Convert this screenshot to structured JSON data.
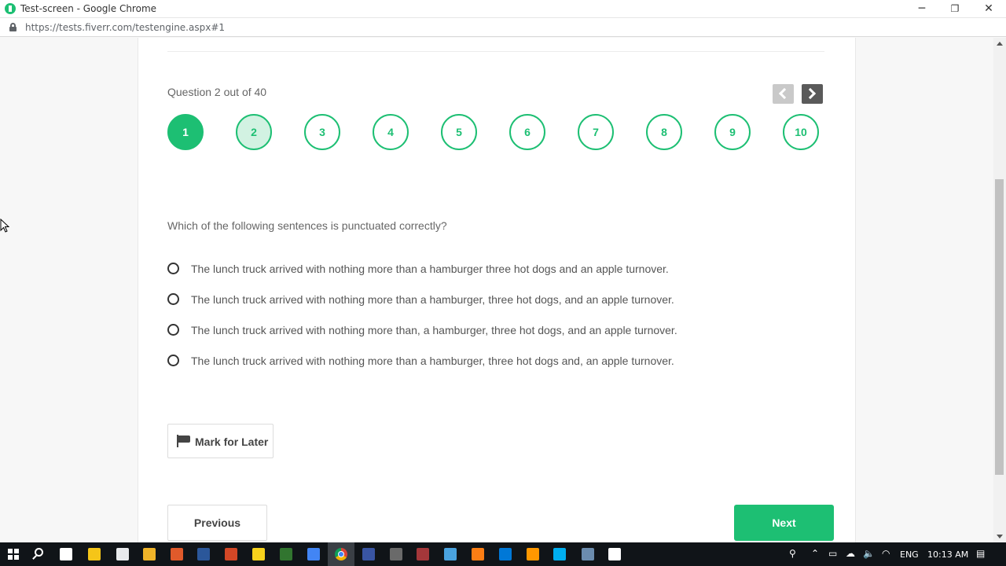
{
  "window": {
    "title": "Test-screen - Google Chrome",
    "minimize_glyph": "─",
    "restore_glyph": "❐",
    "close_glyph": "✕"
  },
  "address_bar": {
    "url": "https://tests.fiverr.com/testengine.aspx#1"
  },
  "test": {
    "question_counter": "Question 2 out of 40",
    "question_numbers": [
      {
        "label": "1",
        "state": "answered"
      },
      {
        "label": "2",
        "state": "current"
      },
      {
        "label": "3",
        "state": "unanswered"
      },
      {
        "label": "4",
        "state": "unanswered"
      },
      {
        "label": "5",
        "state": "unanswered"
      },
      {
        "label": "6",
        "state": "unanswered"
      },
      {
        "label": "7",
        "state": "unanswered"
      },
      {
        "label": "8",
        "state": "unanswered"
      },
      {
        "label": "9",
        "state": "unanswered"
      },
      {
        "label": "10",
        "state": "unanswered"
      }
    ],
    "question_text": "Which of the following sentences is punctuated correctly?",
    "options": [
      "The lunch truck arrived with nothing more than a hamburger three hot dogs and an apple turnover.",
      "The lunch truck arrived with nothing more than a hamburger, three hot dogs, and an apple turnover.",
      "The lunch truck arrived with nothing more than, a hamburger, three hot dogs, and an apple turnover.",
      "The lunch truck arrived with nothing more than a hamburger, three hot dogs and, an apple turnover."
    ],
    "mark_later_label": "Mark for Later",
    "previous_label": "Previous",
    "next_label": "Next"
  },
  "colors": {
    "accent": "#1dbf73",
    "accent_light": "#d2f2e2",
    "taskbar": "#101418"
  },
  "taskbar": {
    "icons": [
      "windows-start-icon",
      "search-icon",
      "task-view-icon",
      "store-icon",
      "file-explorer-icon",
      "calculator-icon",
      "paint-icon",
      "vlc-icon",
      "word-icon",
      "powerpoint-icon",
      "sticky-notes-icon",
      "project-icon",
      "chrome-icon",
      "excel-icon",
      "visio-icon",
      "settings-icon",
      "access-icon",
      "snipping-tool-icon",
      "xampp-icon",
      "vscode-icon",
      "sublime-icon",
      "skype-icon",
      "terminal-icon"
    ],
    "tray": {
      "language": "ENG",
      "time": "10:13 AM"
    }
  }
}
